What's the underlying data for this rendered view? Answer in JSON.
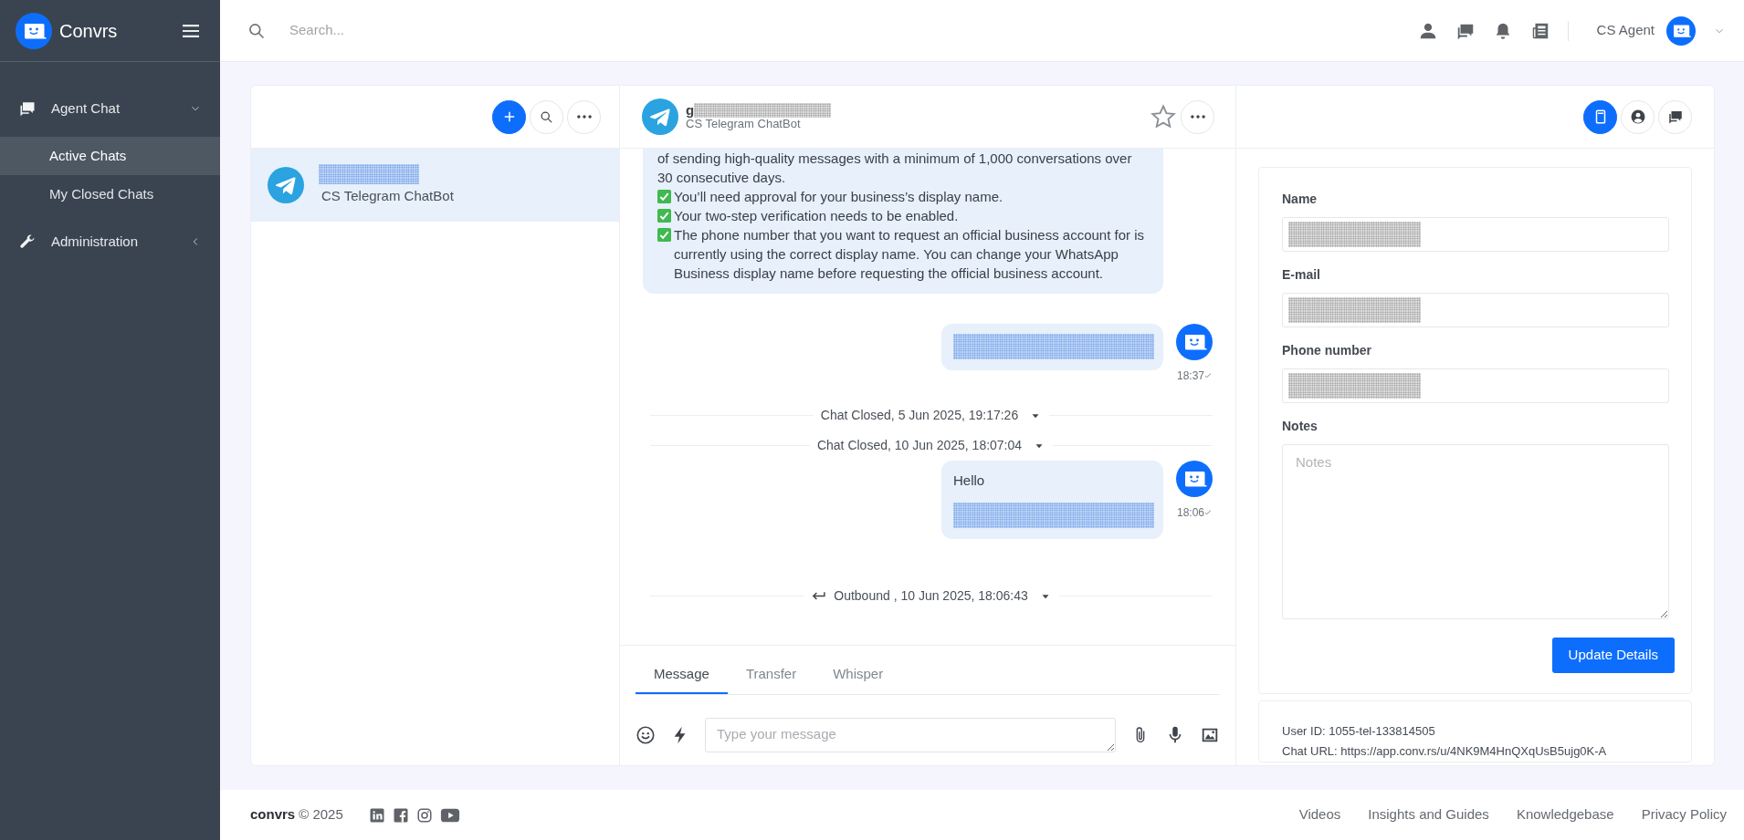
{
  "app": {
    "name": "Convrs"
  },
  "sidebar": {
    "items": [
      {
        "label": "Agent Chat",
        "expanded": true,
        "children": [
          {
            "label": "Active Chats",
            "selected": true
          },
          {
            "label": "My Closed Chats",
            "selected": false
          }
        ]
      },
      {
        "label": "Administration",
        "expanded": false
      }
    ]
  },
  "topbar": {
    "search_placeholder": "Search...",
    "user": "CS Agent"
  },
  "chat_list": [
    {
      "name_redacted": true,
      "channel": "CS Telegram ChatBot",
      "selected": true
    }
  ],
  "conversation": {
    "title": "g",
    "title_redacted": true,
    "channel": "CS Telegram ChatBot",
    "starred": false,
    "timeline": [
      {
        "kind": "bot",
        "lines": [
          {
            "kind": "text",
            "text": "of sending high-quality messages with a minimum of 1,000 conversations over 30 consecutive days."
          },
          {
            "kind": "check",
            "text": "You’ll need approval for your business’s display name."
          },
          {
            "kind": "check",
            "text": "Your two-step verification needs to be enabled."
          },
          {
            "kind": "check",
            "text": "The phone number that you want to request an official business account for is currently using the correct display name. You can change your WhatsApp Business display name before requesting the official business account."
          }
        ]
      },
      {
        "kind": "agent",
        "redacted": true,
        "time": "18:37"
      },
      {
        "kind": "event",
        "text": "Chat Closed, 5 Jun 2025, 19:17:26"
      },
      {
        "kind": "event",
        "text": "Chat Closed, 10 Jun 2025, 18:07:04"
      },
      {
        "kind": "agent",
        "text": "Hello",
        "redacted": true,
        "time": "18:06"
      },
      {
        "kind": "outbound",
        "text": "Outbound , 10 Jun 2025, 18:06:43"
      }
    ],
    "composer_tabs": [
      {
        "label": "Message",
        "selected": true
      },
      {
        "label": "Transfer",
        "selected": false
      },
      {
        "label": "Whisper",
        "selected": false
      }
    ],
    "composer_placeholder": "Type your message"
  },
  "details": {
    "tabs": [
      {
        "selected": true
      },
      {
        "selected": false
      },
      {
        "selected": false
      }
    ],
    "fields": [
      {
        "kind": "input",
        "label": "Name",
        "redacted": true
      },
      {
        "kind": "input",
        "label": "E-mail",
        "redacted": true
      },
      {
        "kind": "input",
        "label": "Phone number",
        "redacted": true
      },
      {
        "kind": "textarea",
        "label": "Notes",
        "placeholder": "Notes"
      }
    ],
    "button": "Update Details",
    "info": [
      "User ID: 1055-tel-133814505",
      "Chat URL: https://app.conv.rs/u/4NK9M4HnQXqUsB5ujg0K-A"
    ]
  },
  "footer": {
    "brand": "convrs",
    "copyright": "© 2025",
    "links": [
      "Videos",
      "Insights and Guides",
      "Knowledgebase",
      "Privacy Policy"
    ]
  }
}
